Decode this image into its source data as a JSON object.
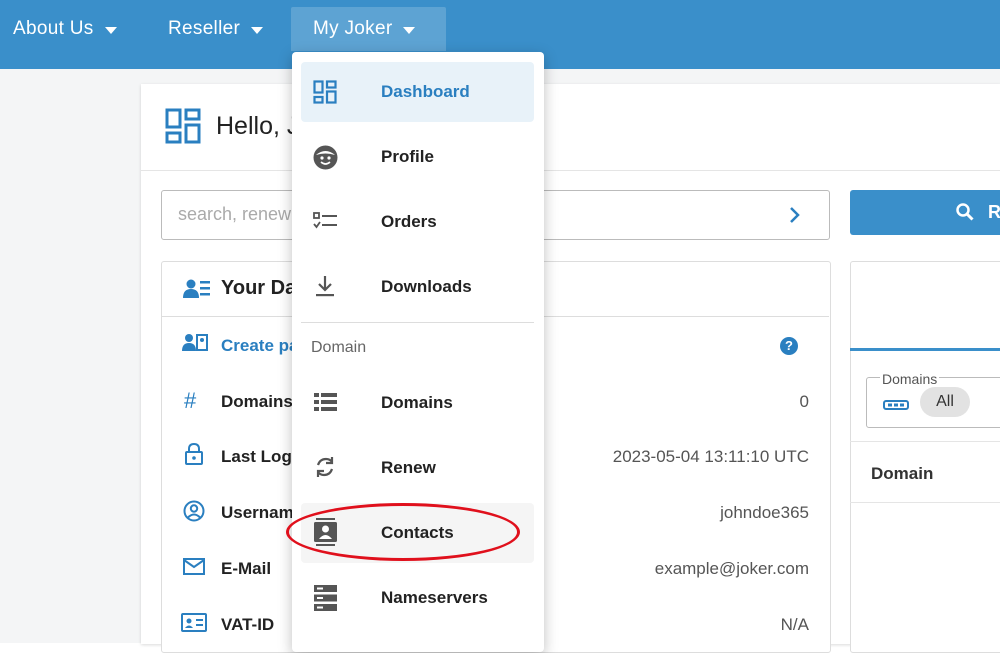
{
  "nav": {
    "items": [
      {
        "label": "About Us"
      },
      {
        "label": "Reseller"
      },
      {
        "label": "My Joker"
      }
    ]
  },
  "main": {
    "greeting": "Hello, J",
    "search": {
      "placeholder": "search, renew",
      "button_label": "R"
    },
    "data_card": {
      "title": "Your Da",
      "create_link": "Create pa",
      "help": "?",
      "rows": [
        {
          "label": "Domains",
          "value": "0"
        },
        {
          "label": "Last Logi",
          "value": "2023-05-04 13:11:10 UTC"
        },
        {
          "label": "Usernam",
          "value": "johndoe365"
        },
        {
          "label": "E-Mail",
          "value": "example@joker.com"
        },
        {
          "label": "VAT-ID",
          "value": "N/A"
        }
      ]
    },
    "right_card": {
      "filter_label": "Domains",
      "chip": "All",
      "column": "Domain"
    }
  },
  "dropdown": {
    "items_top": [
      {
        "label": "Dashboard",
        "icon": "dashboard-icon"
      },
      {
        "label": "Profile",
        "icon": "profile-icon"
      },
      {
        "label": "Orders",
        "icon": "orders-icon"
      },
      {
        "label": "Downloads",
        "icon": "download-icon"
      }
    ],
    "section": "Domain",
    "items_domain": [
      {
        "label": "Domains",
        "icon": "list-icon"
      },
      {
        "label": "Renew",
        "icon": "renew-icon"
      },
      {
        "label": "Contacts",
        "icon": "contacts-icon"
      },
      {
        "label": "Nameservers",
        "icon": "server-icon"
      }
    ]
  },
  "colors": {
    "primary": "#3a8fca",
    "link": "#2a7fc0",
    "annotation": "#e0101c"
  }
}
